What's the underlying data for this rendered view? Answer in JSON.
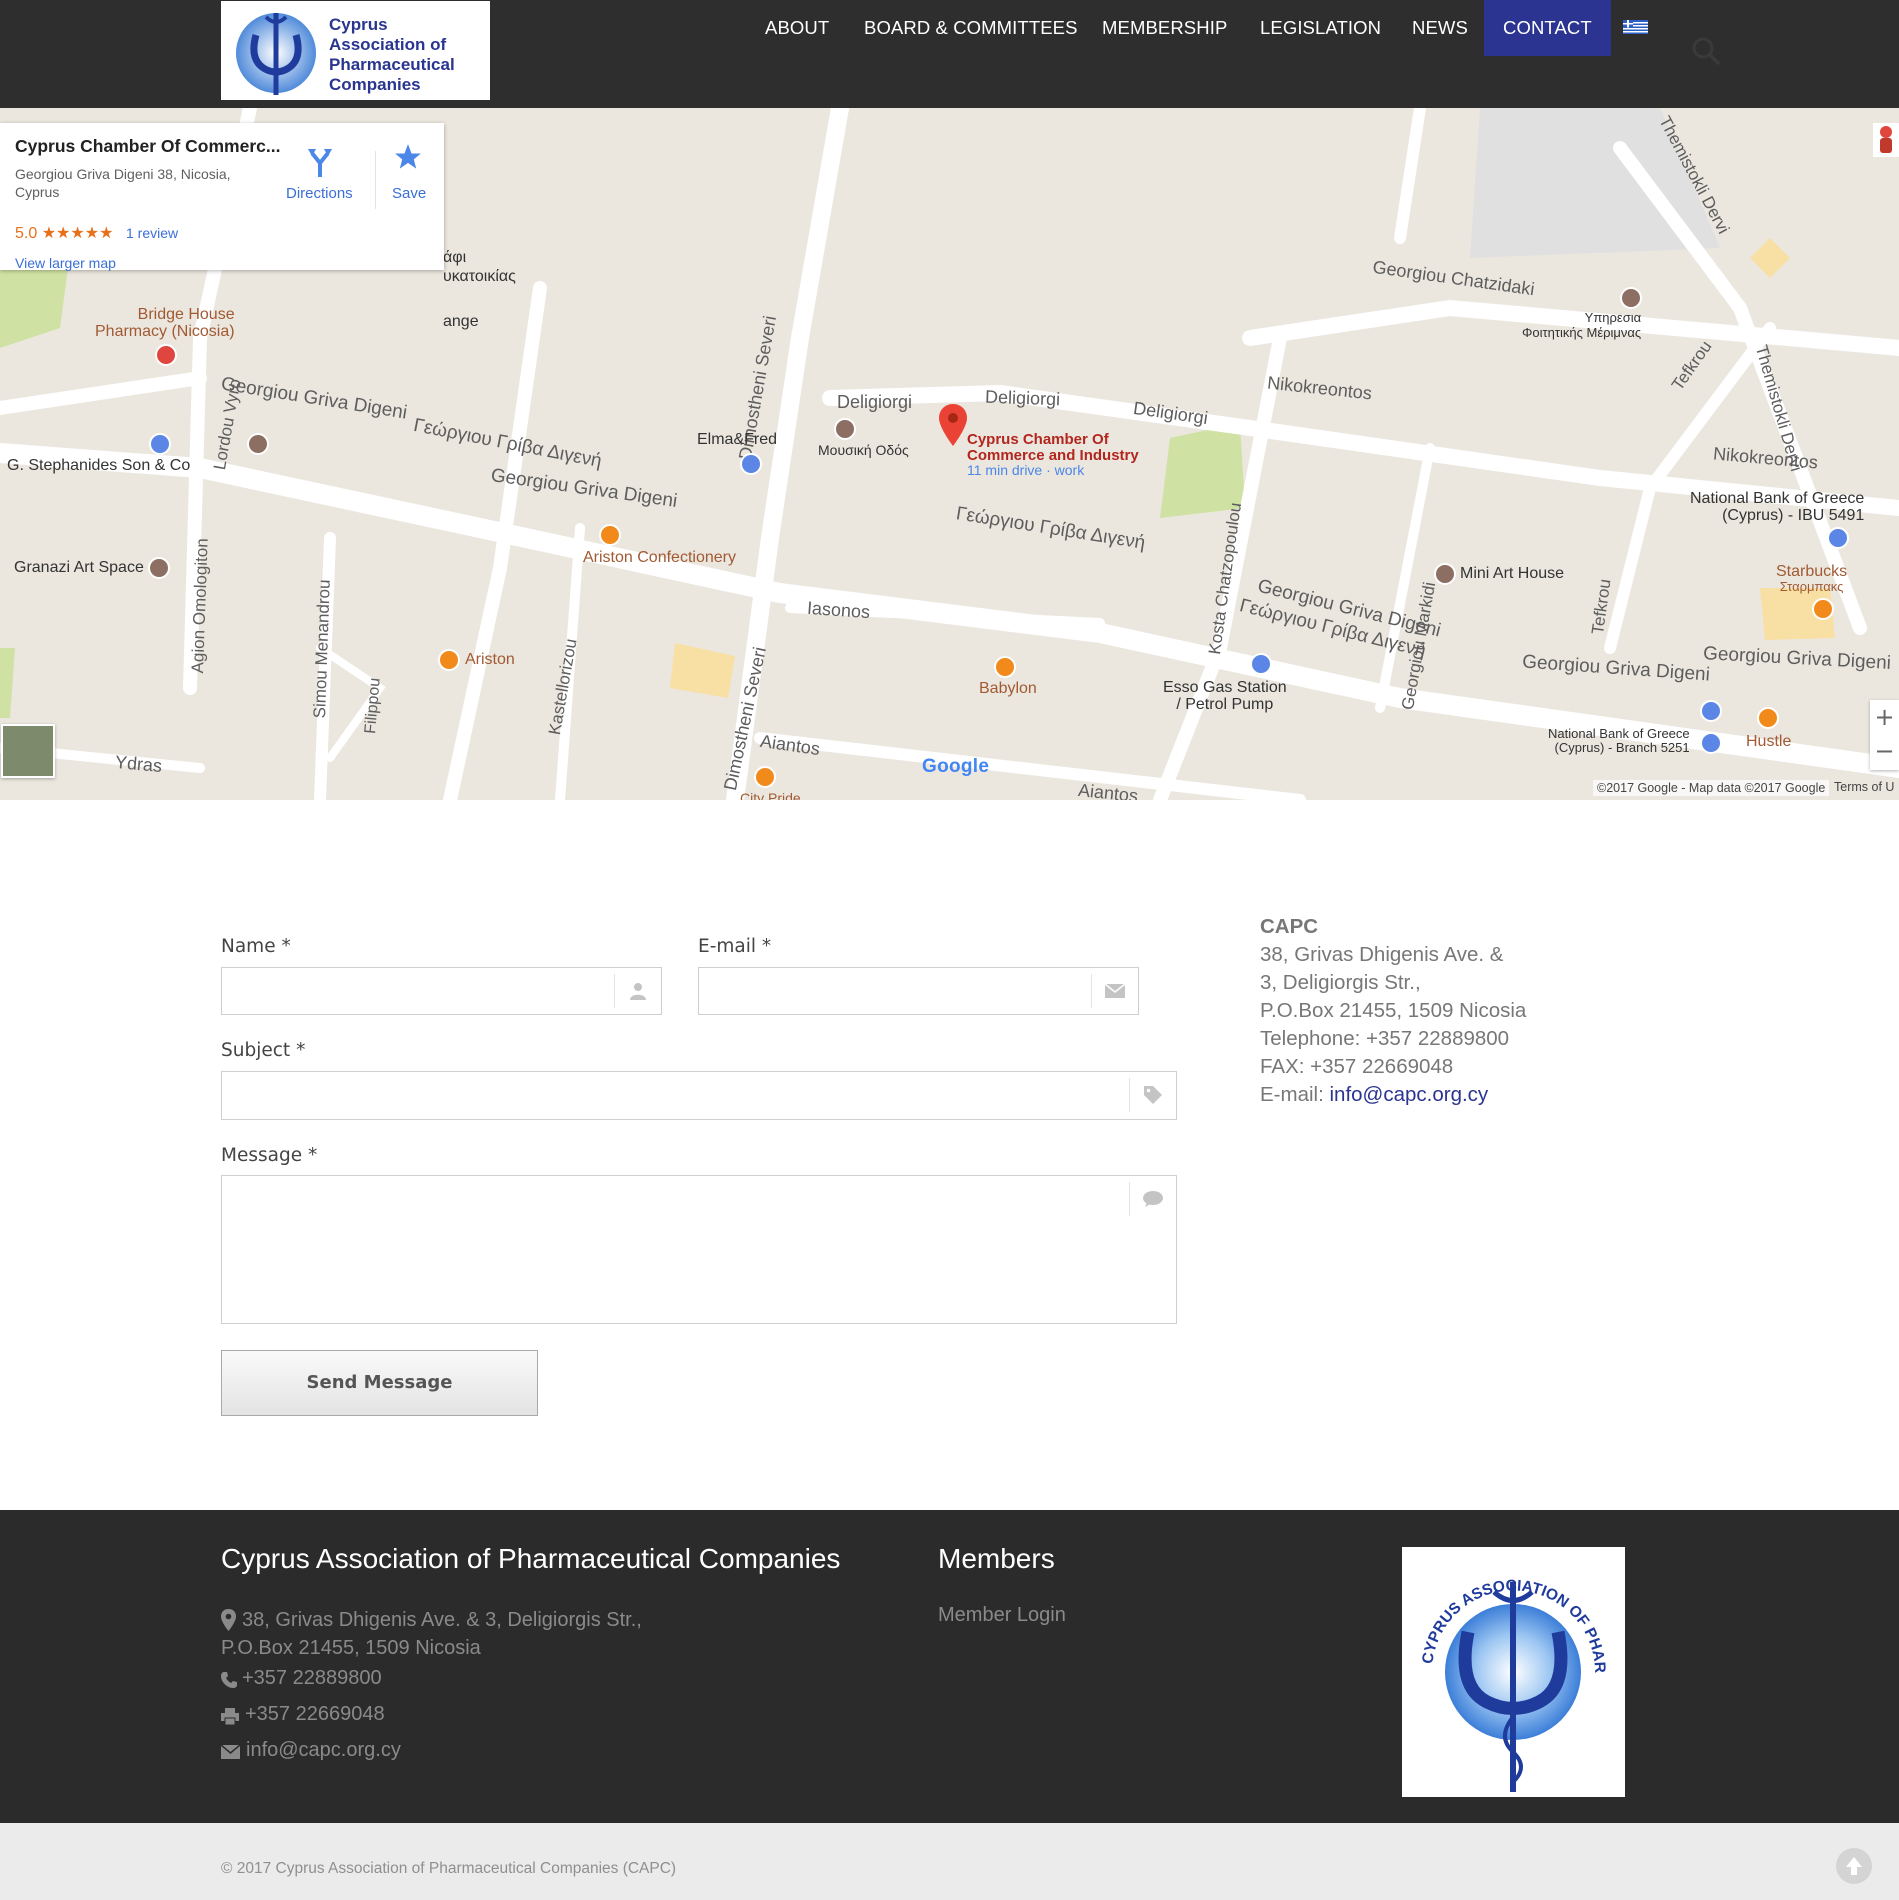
{
  "header": {
    "logo_text": [
      "Cyprus",
      "Association of",
      "Pharmaceutical",
      "Companies"
    ],
    "nav": [
      {
        "label": "ABOUT"
      },
      {
        "label": "BOARD & COMMITTEES"
      },
      {
        "label": "MEMBERSHIP"
      },
      {
        "label": "LEGISLATION"
      },
      {
        "label": "NEWS"
      },
      {
        "label": "CONTACT",
        "active": true
      }
    ],
    "language_flag": "greek-flag-icon",
    "search_icon": "search-icon"
  },
  "map": {
    "card": {
      "title": "Cyprus Chamber Of Commerc...",
      "address": "Georgiou Griva Digeni 38, Nicosia, Cyprus",
      "rating": "5.0",
      "stars": "★★★★★",
      "reviews": "1 review",
      "larger_map": "View larger map",
      "directions": "Directions",
      "save": "Save"
    },
    "marker": {
      "name_line1": "Cyprus Chamber Of",
      "name_line2": "Commerce and Industry",
      "drive": "11 min drive · work"
    },
    "labels": {
      "deligiorgi": "Deligiorgi",
      "nikokreontos": "Nikokreontos",
      "georgiou_chatzidaki": "Georgiou Chatzidaki",
      "georgiou_griva_digeni": "Georgiou Griva Digeni",
      "georgiou_griva_digeni_gr": "Γεώργιου Γρίβα Διγενή",
      "dimostheni_severi": "Dimostheni Severi",
      "iasonos": "Iasonos",
      "aiantos": "Aiantos",
      "ydras": "Ydras",
      "lordou_vyronos": "Lordou Vyro",
      "agion_omologiton": "Agion Omologiton",
      "simou_menandrou": "Simou Menandrou",
      "kastellorizou": "Kastellorizou",
      "kosta_chatzopoulou": "Kosta Chatzopoulou",
      "georgiou_markidi": "Georgiou Markidi",
      "tefkrou": "Tefkrou",
      "themistokli_dervi": "Themistokli Dervi",
      "filippou": "Filippou",
      "bridge_house": "Bridge House",
      "bridge_house_2": "Pharmacy (Nicosia)",
      "stephanides": "G. Stephanides Son & Co",
      "granazi": "Granazi Art Space",
      "elma_fred": "Elma&Fred",
      "mousiki_odos": "Μουσική Οδός",
      "ariston_conf": "Ariston Confectionery",
      "ariston": "Ariston",
      "babylon": "Babylon",
      "esso_1": "Esso Gas Station",
      "esso_2": "/ Petrol Pump",
      "mini_art_house": "Mini Art House",
      "nbg_ibu_1": "National Bank of Greece",
      "nbg_ibu_2": "(Cyprus) - IBU 5491",
      "starbucks_1": "Starbucks",
      "starbucks_2": "Σταρμπακς",
      "hustle": "Hustle",
      "nbg_branch_1": "National Bank of Greece",
      "nbg_branch_2": "(Cyprus) - Branch 5251",
      "ypiresia_1": "Υπηρεσια",
      "ypiresia_2": "Φοιτητικής Μέριμνας",
      "city_pride": "City Pride",
      "ange": "ange",
      "gr_afi": "άφι",
      "gr_kat": "υκατοικίας"
    },
    "footer": "©2017 Google - Map data ©2017 Google",
    "terms": "Terms of U",
    "google_logo": "Google"
  },
  "form": {
    "name_label": "Name",
    "email_label": "E-mail",
    "subject_label": "Subject",
    "message_label": "Message",
    "required_mark": "*",
    "name_value": "",
    "email_value": "",
    "subject_value": "",
    "message_value": "",
    "send_label": "Send Message"
  },
  "contact_info": {
    "name": "CAPC",
    "address_1": "38, Grivas Dhigenis Ave. &",
    "address_2": "3, Deligiorgis Str.,",
    "po_box": "P.O.Box 21455, 1509 Nicosia",
    "telephone": "Telephone: +357 22889800",
    "fax": "FAX: +357 22669048",
    "email_label": "E-mail: ",
    "email": "info@capc.org.cy"
  },
  "footer": {
    "title": "Cyprus Association of Pharmaceutical Companies",
    "address_1": "38, Grivas Dhigenis Ave. & 3, Deligiorgis Str.,",
    "address_2": "P.O.Box 21455, 1509 Nicosia",
    "phone": "+357 22889800",
    "fax": "+357 22669048",
    "email": "info@capc.org.cy",
    "members_title": "Members",
    "member_login": "Member Login",
    "logo_text": "CYPRUS ASSOCIATION OF PHARMACEUTICAL COMPANIES"
  },
  "bottom": {
    "copyright": "© 2017 Cyprus Association of Pharmaceutical Companies (CAPC)"
  },
  "colors": {
    "header_bg": "#2e2e2e",
    "nav_active": "#2b3591",
    "footer_bg": "#2b2b2b",
    "link": "#2b3591"
  }
}
